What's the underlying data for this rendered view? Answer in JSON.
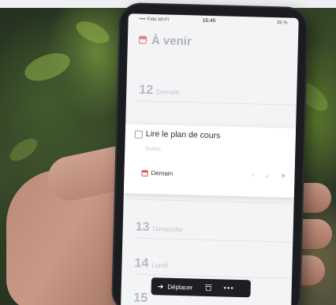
{
  "status_bar": {
    "carrier": "•••• Fido Wi-Fi",
    "time": "15:45",
    "battery": "35 %"
  },
  "header": {
    "icon": "calendar-icon",
    "title": "À venir"
  },
  "days": [
    {
      "num": "12",
      "name": "Demain"
    },
    {
      "num": "13",
      "name": "Dimanche"
    },
    {
      "num": "14",
      "name": "Lundi"
    },
    {
      "num": "15",
      "name": ""
    }
  ],
  "task": {
    "title": "Lire le plan de cours",
    "notes_placeholder": "Notes",
    "due": "Demain",
    "tools": [
      "tag-icon",
      "checklist-icon",
      "flag-icon"
    ]
  },
  "bottom_bar": {
    "move_label": "Déplacer",
    "icons": [
      "arrow-right-icon",
      "trash-icon",
      "more-icon"
    ]
  },
  "colors": {
    "accent_red": "#d94a4a",
    "calendar_pink": "#e57a7a"
  }
}
